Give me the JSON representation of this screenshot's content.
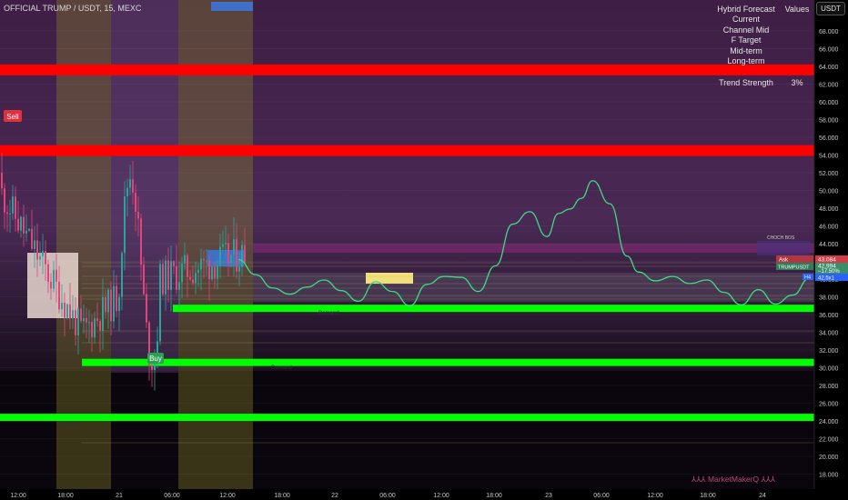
{
  "header": {
    "symbol": "OFFICIAL TRUMP / USDT, 15, MEXC",
    "currency_button": "USDT"
  },
  "table": {
    "header": [
      "Hybrid Forecast",
      "Values"
    ],
    "rows": [
      "Current",
      "Channel Mid",
      "F Target",
      "Mid-term",
      "Long-term"
    ],
    "trend_label": "Trend Strength",
    "trend_value": "3%"
  },
  "price_axis": {
    "ticks": [
      "68.000",
      "66.000",
      "64.000",
      "62.000",
      "60.000",
      "58.000",
      "56.000",
      "54.000",
      "52.000",
      "50.000",
      "48.000",
      "46.000",
      "44.000",
      "42.000",
      "40.000",
      "38.000",
      "36.000",
      "34.000",
      "32.000",
      "30.000",
      "28.000",
      "26.000",
      "24.000",
      "22.000",
      "20.000",
      "18.000"
    ],
    "ask_label": "Ask",
    "ask_value": "43.084",
    "last_symbol": "TRUMPUSDT",
    "last_value": "42.994",
    "last_change": "−17.50%",
    "hi_label": "H4",
    "hi_value": "42.5x1"
  },
  "time_axis": {
    "ticks": [
      "12:00",
      "18:00",
      "21",
      "06:00",
      "12:00",
      "18:00",
      "22",
      "06:00",
      "12:00",
      "18:00",
      "23",
      "06:00",
      "12:00",
      "18:00",
      "24"
    ]
  },
  "annotations": {
    "sell": "Sell",
    "buy": "Buy",
    "demand_1": "Demand",
    "demand_2": "Demand",
    "demand_3": "Demand",
    "choch_bos": "CHOCH BOS"
  },
  "watermark": "⅄⅄⅄ MarketMakerQ ⅄⅄⅄",
  "colors": {
    "supply": "#ff0000",
    "demand": "#00ff00",
    "forecast": "#3ddc84",
    "accent": "#2962ff",
    "zone": "#4a2a55"
  },
  "chart_data": {
    "type": "line",
    "price_range": [
      18,
      69
    ],
    "supply_levels": [
      63.6,
      54.5
    ],
    "demand_levels": [
      36.7,
      30.6,
      24.4
    ],
    "forecast": {
      "x": [
        0,
        0.03,
        0.06,
        0.09,
        0.12,
        0.15,
        0.18,
        0.21,
        0.24,
        0.27,
        0.3,
        0.33,
        0.36,
        0.39,
        0.42,
        0.45,
        0.48,
        0.51,
        0.54,
        0.56,
        0.58,
        0.6,
        0.62,
        0.65,
        0.68,
        0.7,
        0.73,
        0.76,
        0.79,
        0.82,
        0.85,
        0.88,
        0.91,
        0.94,
        0.97,
        1.0
      ],
      "y": [
        42.2,
        40.5,
        39.0,
        38.3,
        39.1,
        39.9,
        38.7,
        37.5,
        39.7,
        38.6,
        37.0,
        39.4,
        40.3,
        40.2,
        38.6,
        41.5,
        46.2,
        47.6,
        44.8,
        47.4,
        47.9,
        49.1,
        51.1,
        48.5,
        42.6,
        40.8,
        39.8,
        40.3,
        39.5,
        39.9,
        38.5,
        37.1,
        38.8,
        37.2,
        38.2,
        40.1
      ]
    }
  }
}
